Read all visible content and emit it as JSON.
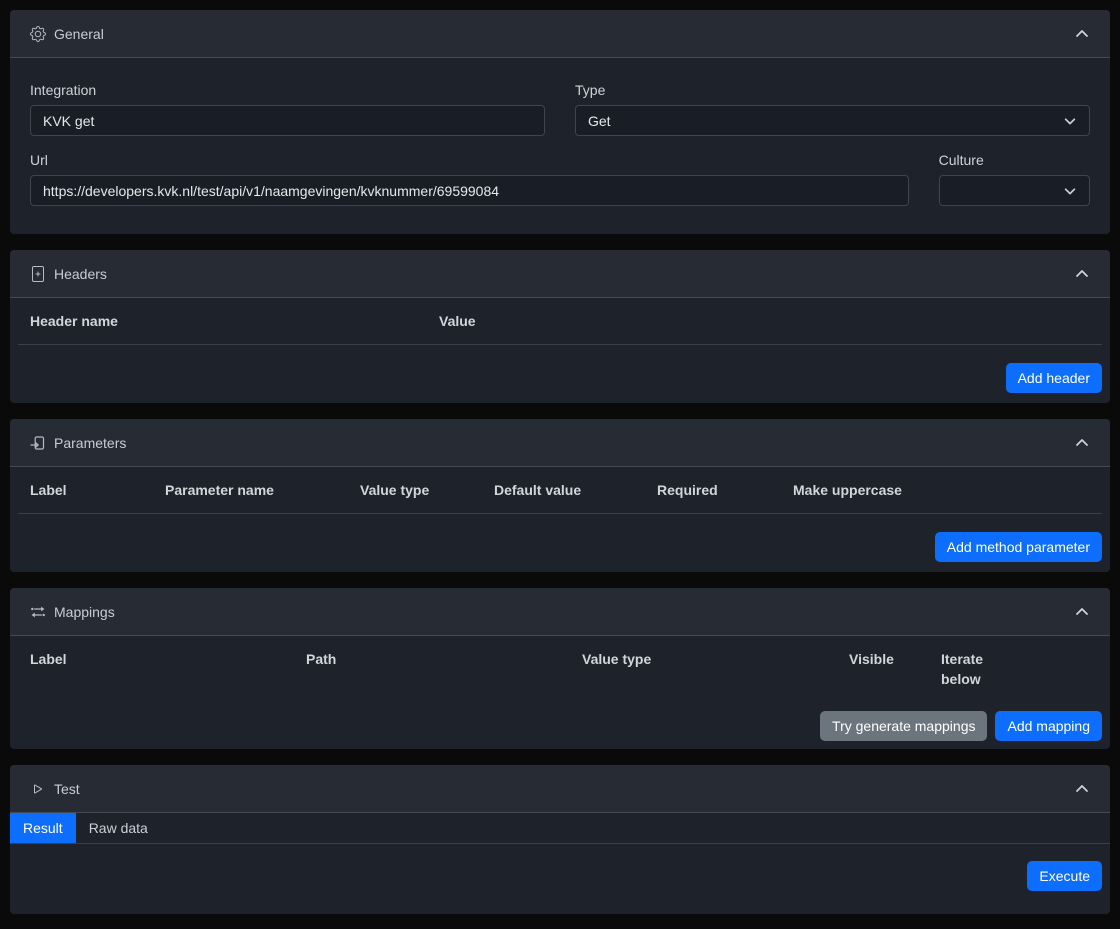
{
  "colors": {
    "accent": "#0d6efd",
    "secondary_button": "#6c757d",
    "card_bg": "#1e222a",
    "card_header_bg": "#262b34",
    "page_bg": "#0a0a0b"
  },
  "sections": {
    "general": {
      "title": "General",
      "icon": "gear-icon",
      "fields": {
        "integration": {
          "label": "Integration",
          "value": "KVK get"
        },
        "type": {
          "label": "Type",
          "value": "Get"
        },
        "url": {
          "label": "Url",
          "value": "https://developers.kvk.nl/test/api/v1/naamgevingen/kvknummer/69599084"
        },
        "culture": {
          "label": "Culture",
          "value": ""
        }
      }
    },
    "headers": {
      "title": "Headers",
      "icon": "file-plus-icon",
      "columns": [
        "Header name",
        "Value"
      ],
      "rows": [],
      "add_button": "Add header"
    },
    "parameters": {
      "title": "Parameters",
      "icon": "file-arrow-icon",
      "columns": [
        "Label",
        "Parameter name",
        "Value type",
        "Default value",
        "Required",
        "Make uppercase"
      ],
      "rows": [],
      "add_button": "Add method parameter"
    },
    "mappings": {
      "title": "Mappings",
      "icon": "swap-arrows-icon",
      "columns": [
        "Label",
        "Path",
        "Value type",
        "Visible",
        "Iterate below"
      ],
      "rows": [],
      "generate_button": "Try generate mappings",
      "add_button": "Add mapping"
    },
    "test": {
      "title": "Test",
      "icon": "play-icon",
      "tabs": [
        {
          "label": "Result",
          "active": true
        },
        {
          "label": "Raw data",
          "active": false
        }
      ],
      "execute_button": "Execute"
    }
  }
}
